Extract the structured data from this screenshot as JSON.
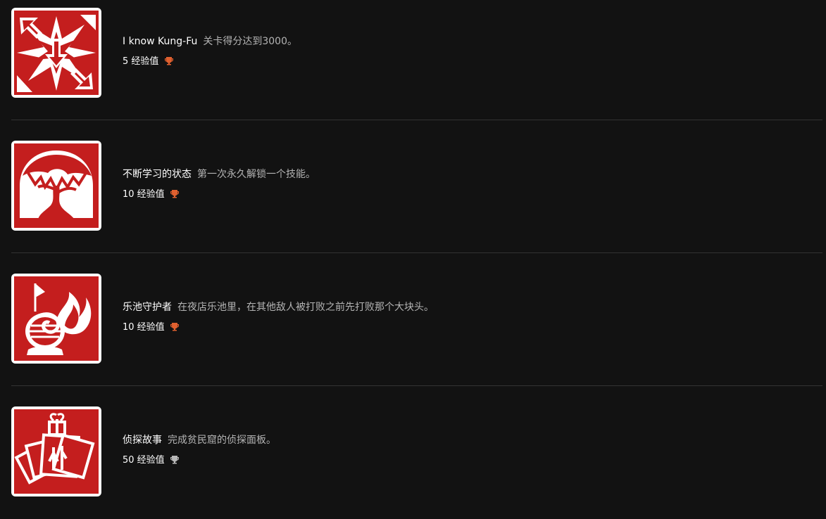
{
  "achievements": [
    {
      "title": "I know Kung-Fu",
      "description": "关卡得分达到3000。",
      "xp": "5 经验值",
      "trophy_color": "#e0602f",
      "icon": "kung-fu-arrows-icon"
    },
    {
      "title": "不断学习的状态",
      "description": "第一次永久解锁一个技能。",
      "xp": "10 经验值",
      "trophy_color": "#e0602f",
      "icon": "tree-icon"
    },
    {
      "title": "乐池守护者",
      "description": "在夜店乐池里，在其他敌人被打败之前先打败那个大块头。",
      "xp": "10 经验值",
      "trophy_color": "#e0602f",
      "icon": "flame-urn-icon"
    },
    {
      "title": "侦探故事",
      "description": "完成贫民窟的侦探面板。",
      "xp": "50 经验值",
      "trophy_color": "#b8b8b8",
      "icon": "detective-cards-icon"
    }
  ],
  "colors": {
    "background": "#121212",
    "icon_red": "#c41e1e",
    "divider": "#333333"
  }
}
